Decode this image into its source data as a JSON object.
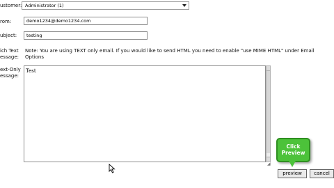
{
  "form": {
    "customer_label": "ustomer:",
    "customer_value": "Administrator (1)",
    "from_label": "rom:",
    "from_value": "demo1234@demo1234.com",
    "subject_label": "ubject:",
    "subject_value": "testing",
    "rich_text_label_1": "ich Text",
    "rich_text_label_2": "essage:",
    "rich_text_note": "Note: You are using TEXT only email. If you would like to send HTML you need to enable \"use MIME HTML\" under Email Options",
    "text_only_label_1": "ext-Only",
    "text_only_label_2": "essage:",
    "text_only_value": "Test"
  },
  "buttons": {
    "preview_label": "preview",
    "cancel_label": "cancel"
  },
  "callout": {
    "line1": "Click",
    "line2": "Preview"
  },
  "colors": {
    "callout": "#4cc23a"
  }
}
